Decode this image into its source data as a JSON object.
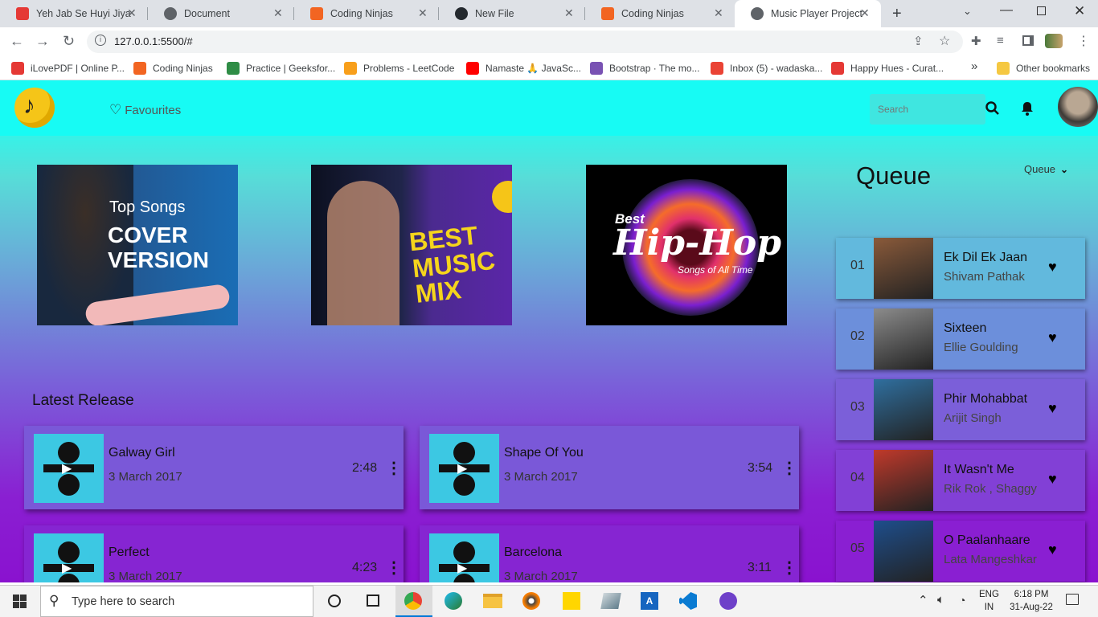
{
  "browser": {
    "tabs": [
      {
        "title": "Yeh Jab Se Huyi Jiya K",
        "icon": "pdf-icon",
        "color": "#e53935"
      },
      {
        "title": "Document",
        "icon": "globe-icon",
        "color": "#5f6368"
      },
      {
        "title": "Coding Ninjas",
        "icon": "coding-ninjas-icon",
        "color": "#f26522"
      },
      {
        "title": "New File",
        "icon": "github-icon",
        "color": "#24292e"
      },
      {
        "title": "Coding Ninjas",
        "icon": "coding-ninjas-icon",
        "color": "#f26522"
      },
      {
        "title": "Music Player Project",
        "icon": "globe-icon",
        "color": "#5f6368"
      }
    ],
    "url": "127.0.0.1:5500/#",
    "bookmarks": [
      {
        "label": "iLovePDF | Online P...",
        "color": "#e53935"
      },
      {
        "label": "Coding Ninjas",
        "color": "#f26522"
      },
      {
        "label": "Practice | Geeksfor...",
        "color": "#2f8d46"
      },
      {
        "label": "Problems - LeetCode",
        "color": "#f89f1b"
      },
      {
        "label": "Namaste 🙏 JavaSc...",
        "color": "#ff0000"
      },
      {
        "label": "Bootstrap · The mo...",
        "color": "#7952b3"
      },
      {
        "label": "Inbox (5) - wadaska...",
        "color": "#ea4335"
      },
      {
        "label": "Happy Hues - Curat...",
        "color": "#e53935"
      }
    ],
    "more_bookmarks": "»",
    "other_bookmarks": "Other bookmarks"
  },
  "app": {
    "favourites_label": "Favourites",
    "search_placeholder": "Search",
    "queue_title": "Queue",
    "queue_dropdown": "Queue",
    "latest_title": "Latest Release",
    "banners": [
      {
        "line1": "Top Songs",
        "line2": "COVER",
        "line3": "VERSION"
      },
      {
        "line1": "BEST",
        "line2": "MUSIC",
        "line3": "MIX"
      },
      {
        "line1": "Best",
        "line2": "Hip-Hop",
        "line3": "Songs of All Time"
      }
    ],
    "latest": [
      {
        "title": "Galway Girl",
        "date": "3 March 2017",
        "duration": "2:48"
      },
      {
        "title": "Shape Of You",
        "date": "3 March 2017",
        "duration": "3:54"
      },
      {
        "title": "Perfect",
        "date": "3 March 2017",
        "duration": "4:23"
      },
      {
        "title": "Barcelona",
        "date": "3 March 2017",
        "duration": "3:11"
      }
    ],
    "queue": [
      {
        "num": "01",
        "title": "Ek Dil Ek Jaan",
        "artist": "Shivam Pathak",
        "bg": "#62b9dd",
        "thumb": "#8a5a3a"
      },
      {
        "num": "02",
        "title": "Sixteen",
        "artist": "Ellie Goulding",
        "bg": "#6c8fdb",
        "thumb": "#8b8b8b"
      },
      {
        "num": "03",
        "title": "Phir Mohabbat",
        "artist": "Arijit Singh",
        "bg": "#7b5fd9",
        "thumb": "#2f6f9f"
      },
      {
        "num": "04",
        "title": "It Wasn't Me",
        "artist": "Rik Rok , Shaggy",
        "bg": "#8240d6",
        "thumb": "#c0392b"
      },
      {
        "num": "05",
        "title": "O Paalanhaare",
        "artist": "Lata Mangeshkar",
        "bg": "#8a1fd2",
        "thumb": "#1e4e8c"
      }
    ]
  },
  "taskbar": {
    "search_placeholder": "Type here to search",
    "lang1": "ENG",
    "lang2": "IN",
    "time": "6:18 PM",
    "date": "31-Aug-22"
  }
}
